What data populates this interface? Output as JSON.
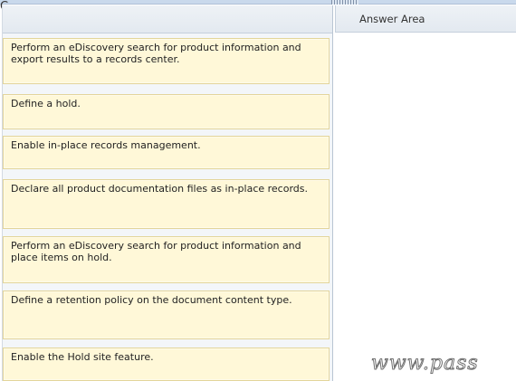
{
  "corner_glyph": "C",
  "answer_area": {
    "title": "Answer Area"
  },
  "items": [
    {
      "label": "Perform an eDiscovery search for product information and export results to a records center."
    },
    {
      "label": "Define a hold."
    },
    {
      "label": "Enable in-place records management."
    },
    {
      "label": "Declare all product documentation files as in-place records."
    },
    {
      "label": "Perform an eDiscovery search for product information and place items on hold."
    },
    {
      "label": "Define a retention policy on the document content type."
    },
    {
      "label": "Enable the Hold site feature."
    }
  ],
  "watermark": "www.pass"
}
